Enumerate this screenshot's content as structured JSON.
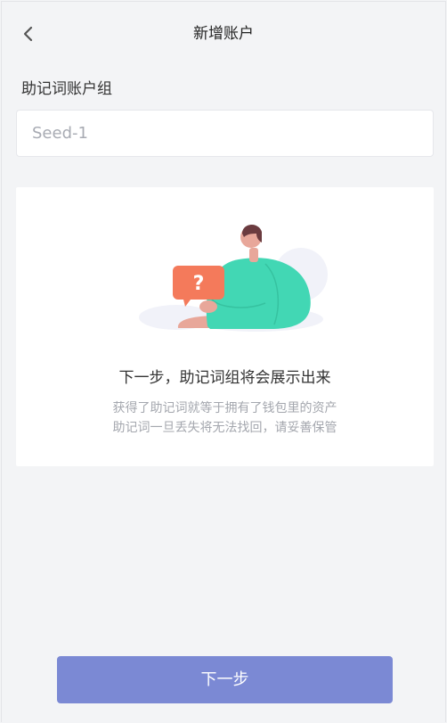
{
  "header": {
    "title": "新增账户",
    "back_icon": "chevron-left-icon"
  },
  "form": {
    "label": "助记词账户组",
    "input_value": "",
    "input_placeholder": "Seed-1"
  },
  "card": {
    "illustration": "person-with-question-bubble",
    "bubble_symbol": "?",
    "title": "下一步，助记词组将会展示出来",
    "desc_line1": "获得了助记词就等于拥有了钱包里的资产",
    "desc_line2": "助记词一旦丢失将无法找回，请妥善保管"
  },
  "footer": {
    "next_label": "下一步"
  },
  "colors": {
    "background": "#f3f4f6",
    "primary_button": "#7b89d4",
    "bubble": "#f47a5b",
    "shirt": "#42d7b4",
    "muted_text": "#a4a7ae"
  }
}
